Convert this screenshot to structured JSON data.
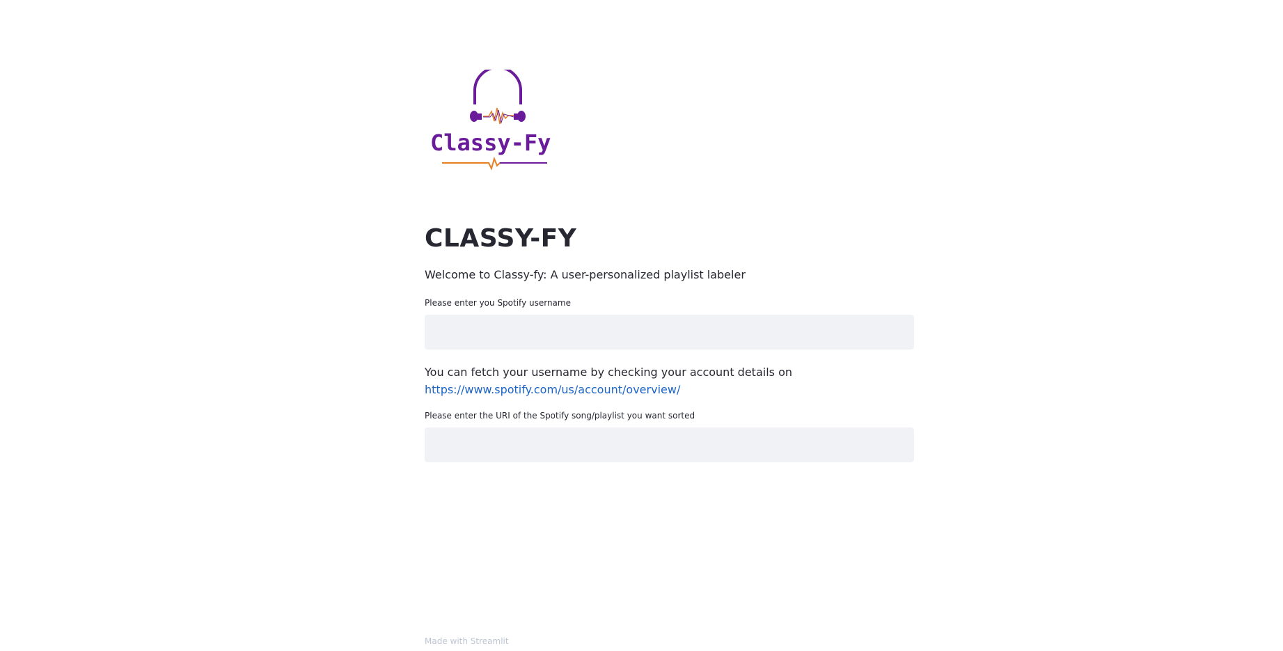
{
  "logo": {
    "text": "Classy-Fy",
    "primary_color": "#6a1b9a",
    "accent_color": "#e67e22"
  },
  "page": {
    "title": "CLASSY-FY",
    "welcome": "Welcome to Classy-fy: A user-personalized playlist labeler"
  },
  "username_field": {
    "label": "Please enter you Spotify username",
    "value": ""
  },
  "help": {
    "text": "You can fetch your username by checking your account details on",
    "link": "https://www.spotify.com/us/account/overview/"
  },
  "uri_field": {
    "label": "Please enter the URI of the Spotify song/playlist you want sorted",
    "value": ""
  },
  "footer": {
    "text": "Made with Streamlit"
  },
  "colors": {
    "link": "#1c64c8",
    "input_bg": "#f0f2f6",
    "text": "#262730",
    "footer": "#bfc5d3"
  }
}
